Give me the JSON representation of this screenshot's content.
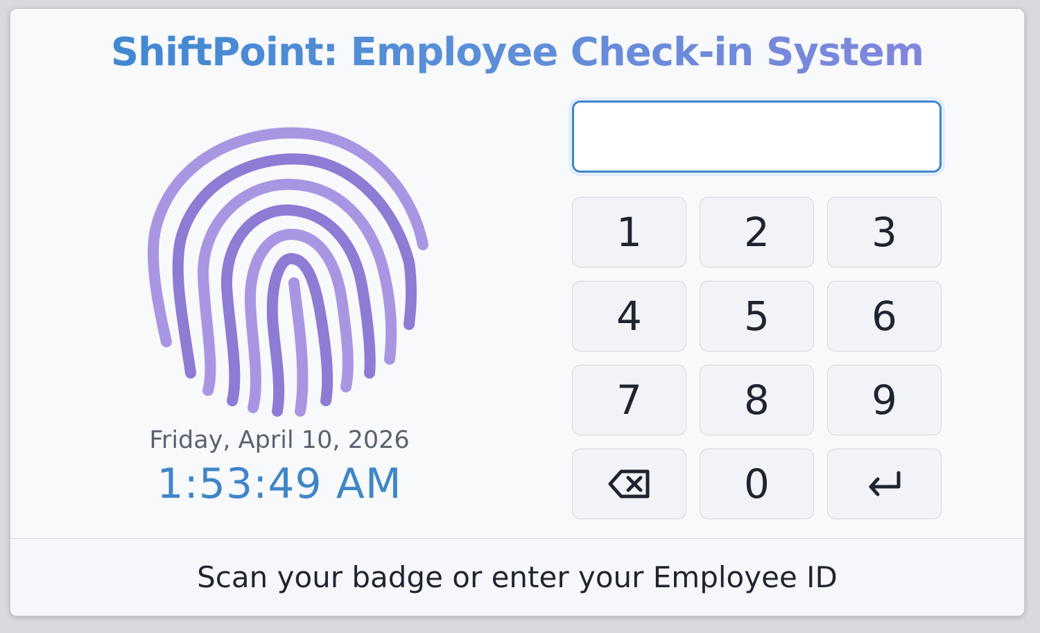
{
  "app": {
    "title": "ShiftPoint: Employee Check-in System"
  },
  "clock": {
    "date": "Friday, April 10, 2026",
    "time": "1:53:49 AM"
  },
  "entry": {
    "value": "",
    "placeholder": ""
  },
  "keypad": {
    "keys": [
      "1",
      "2",
      "3",
      "4",
      "5",
      "6",
      "7",
      "8",
      "9",
      "0"
    ],
    "backspace_icon": "backspace-icon",
    "enter_icon": "enter-return-icon"
  },
  "footer": {
    "instruction": "Scan your badge or enter your Employee ID"
  },
  "colors": {
    "accent_blue": "#3e86c9",
    "accent_purple": "#8b7fd6",
    "fingerprint_light": "#a996e3",
    "fingerprint_dark": "#8d7bd4"
  }
}
